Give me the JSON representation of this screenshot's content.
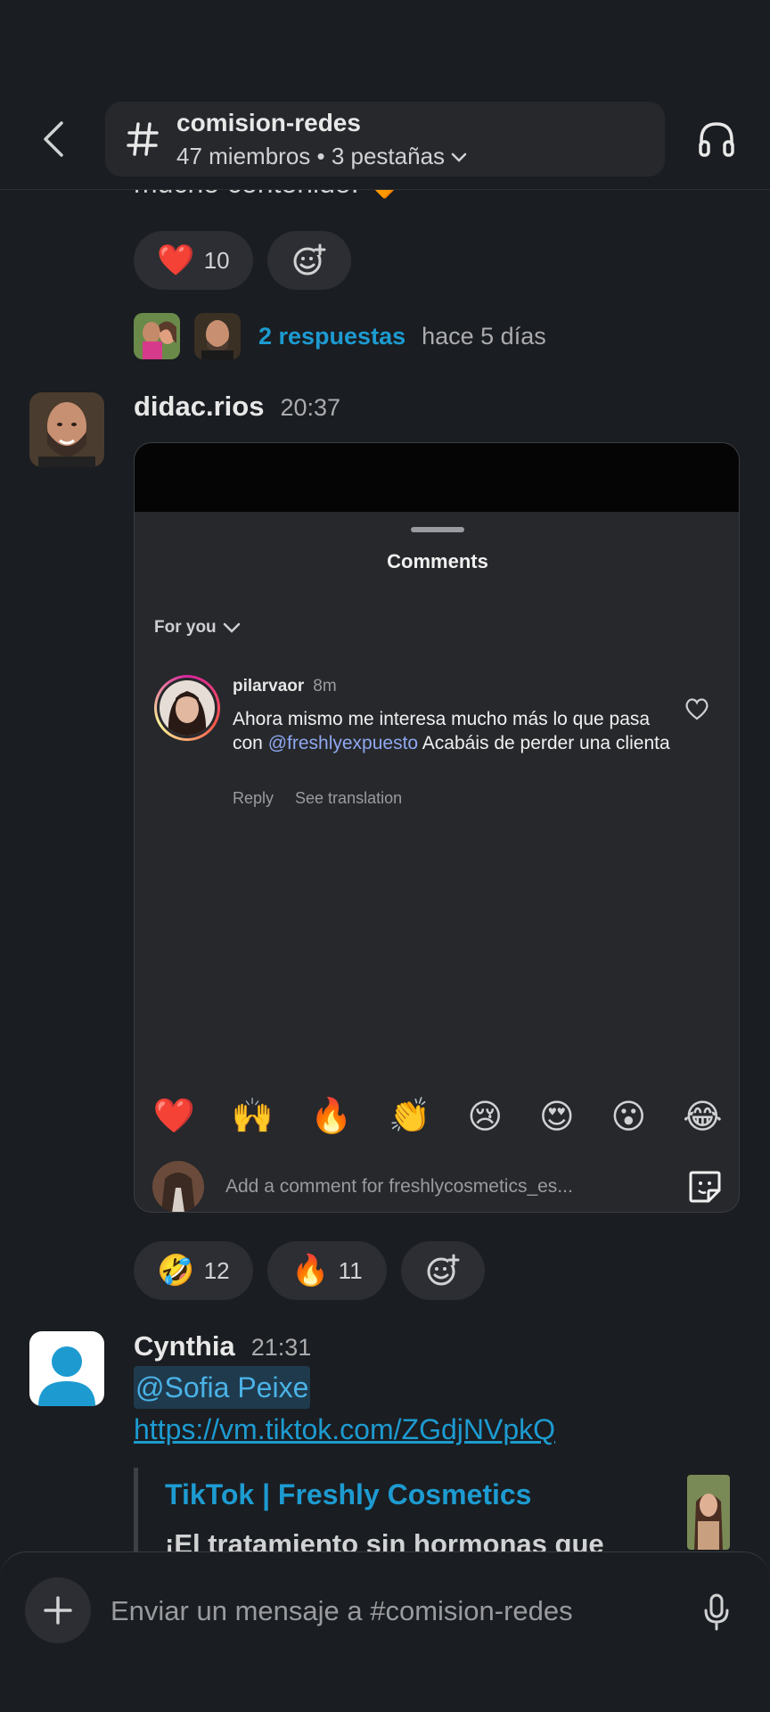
{
  "header": {
    "channel_name": "comision-redes",
    "channel_meta": "47 miembros • 3 pestañas"
  },
  "feed": {
    "clipped_prev_text": "mucho contenido.",
    "prev_reactions": [
      {
        "emoji": "❤️",
        "count": "10"
      }
    ],
    "thread": {
      "replies": "2 respuestas",
      "time": "hace 5 días"
    },
    "message1": {
      "author": "didac.rios",
      "time": "20:37",
      "reactions": [
        {
          "emoji": "🤣",
          "count": "12"
        },
        {
          "emoji": "🔥",
          "count": "11"
        }
      ]
    },
    "embedded_screenshot": {
      "title": "Comments",
      "filter": "For you",
      "comment_user": "pilarvaor",
      "comment_ago": "8m",
      "comment_text_before": "Ahora mismo me interesa mucho más lo que pasa con ",
      "comment_mention": "@freshlyexpuesto",
      "comment_text_after": " Acabáis de perder una clienta",
      "reply_label": "Reply",
      "translation_label": "See translation",
      "emojis": [
        "❤️",
        "🙌",
        "🔥",
        "👏",
        "😢",
        "😍",
        "😮",
        "😂"
      ],
      "input_placeholder": "Add a comment for freshlycosmetics_es..."
    },
    "message2": {
      "author": "Cynthia",
      "time": "21:31",
      "mention": "@Sofia Peixe",
      "link": "https://vm.tiktok.com/ZGdjNVpkQ",
      "unfurl_title": "TikTok | Freshly Cosmetics",
      "unfurl_desc": "¡El tratamiento sin hormonas que"
    }
  },
  "composer": {
    "placeholder": "Enviar un mensaje a #comision-redes"
  },
  "colors": {
    "background": "#1a1d21",
    "link": "#1d9bd1",
    "reaction_bg": "#2c2e33"
  },
  "icons": [
    "back-arrow-icon",
    "hash-icon",
    "chevron-down-icon",
    "headphones-icon",
    "add-reaction-icon",
    "heart-icon",
    "sticker-icon",
    "plus-icon",
    "microphone-icon"
  ]
}
